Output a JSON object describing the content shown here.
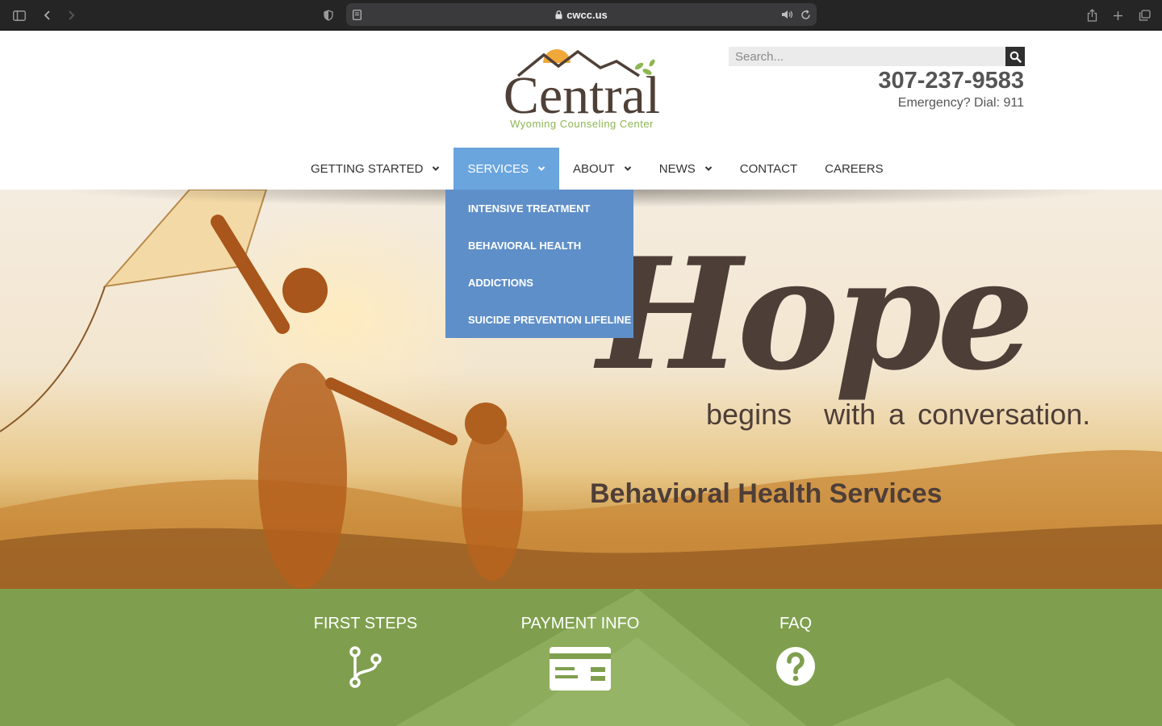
{
  "browser": {
    "url": "cwcc.us"
  },
  "header": {
    "logo_text": "Central",
    "logo_subtitle": "Wyoming Counseling Center",
    "search_placeholder": "Search...",
    "phone": "307-237-9583",
    "emergency": "Emergency? Dial: 911"
  },
  "nav": {
    "items": [
      {
        "label": "GETTING STARTED",
        "has_dropdown": true
      },
      {
        "label": "SERVICES",
        "has_dropdown": true,
        "active": true
      },
      {
        "label": "ABOUT",
        "has_dropdown": true
      },
      {
        "label": "NEWS",
        "has_dropdown": true
      },
      {
        "label": "CONTACT",
        "has_dropdown": false
      },
      {
        "label": "CAREERS",
        "has_dropdown": false
      }
    ]
  },
  "dropdown": {
    "items": [
      {
        "label": "INTENSIVE TREATMENT"
      },
      {
        "label": "BEHAVIORAL HEALTH"
      },
      {
        "label": "ADDICTIONS"
      },
      {
        "label": "SUICIDE PREVENTION LIFELINE"
      }
    ]
  },
  "hero": {
    "headline": "Hope",
    "tagline_left": "begins",
    "tagline_right": "with a conversation.",
    "subheading": "Behavioral Health Services"
  },
  "features": [
    {
      "title": "FIRST STEPS",
      "icon": "branch-icon"
    },
    {
      "title": "PAYMENT INFO",
      "icon": "credit-card-icon"
    },
    {
      "title": "FAQ",
      "icon": "question-circle-icon"
    }
  ],
  "colors": {
    "nav_active": "#6aa5de",
    "dropdown": "#5f8fc8",
    "band": "#7f9f4e",
    "text_brown": "#4e3e38",
    "logo_green": "#8db651"
  }
}
